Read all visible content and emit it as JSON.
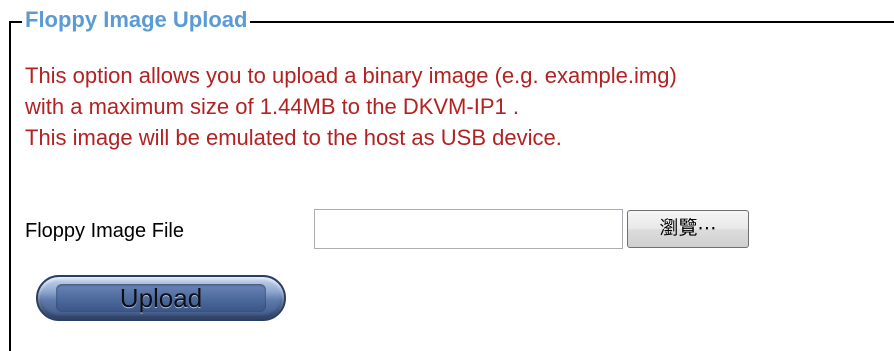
{
  "section": {
    "legend": "Floppy Image Upload"
  },
  "description": {
    "line1": "This option allows you to upload a binary image (e.g. example.img)",
    "line2": "with a maximum size of 1.44MB to the DKVM-IP1 .",
    "line3": "This image will be emulated to the host as USB device."
  },
  "file_field": {
    "label": "Floppy Image File",
    "value": "",
    "browse_label": "瀏覽⋯"
  },
  "actions": {
    "upload_label": "Upload"
  },
  "colors": {
    "legend": "#5b9bd5",
    "description": "#b22222",
    "upload_button": "#4f6c9f"
  }
}
